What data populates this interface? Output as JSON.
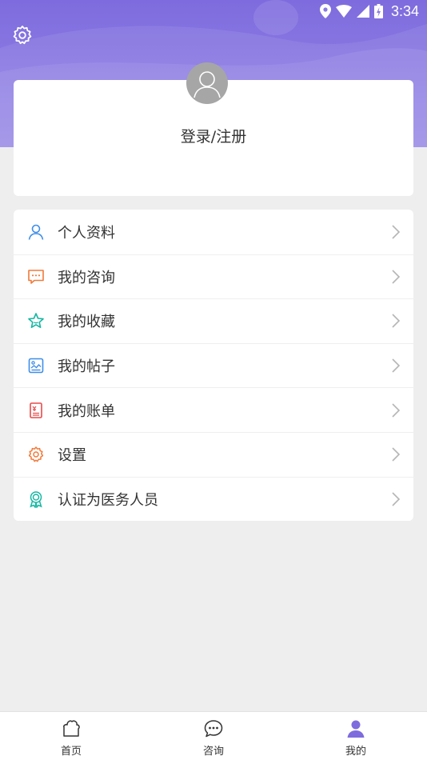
{
  "status_bar": {
    "time": "3:34",
    "icons": [
      "location-icon",
      "wifi-icon",
      "signal-icon",
      "battery-charging-icon"
    ]
  },
  "header": {
    "settings_icon": "gear-icon"
  },
  "profile": {
    "avatar_icon": "user-avatar-icon",
    "login_label": "登录/注册"
  },
  "menu": {
    "items": [
      {
        "label": "个人资料",
        "icon": "user-outline-icon",
        "color": "#3f8ee8"
      },
      {
        "label": "我的咨询",
        "icon": "chat-bubble-icon",
        "color": "#f07a3a"
      },
      {
        "label": "我的收藏",
        "icon": "star-icon",
        "color": "#17b7a3"
      },
      {
        "label": "我的帖子",
        "icon": "image-post-icon",
        "color": "#3f8ee8"
      },
      {
        "label": "我的账单",
        "icon": "bill-icon",
        "color": "#e84a4a"
      },
      {
        "label": "设置",
        "icon": "gear-icon",
        "color": "#f07a3a"
      },
      {
        "label": "认证为医务人员",
        "icon": "badge-icon",
        "color": "#17b7a3"
      }
    ]
  },
  "bottom_nav": {
    "tabs": [
      {
        "label": "首页",
        "icon": "home-icon",
        "active": false
      },
      {
        "label": "咨询",
        "icon": "chat-icon",
        "active": false
      },
      {
        "label": "我的",
        "icon": "person-icon",
        "active": true
      }
    ],
    "active_color": "#7e6cde"
  }
}
